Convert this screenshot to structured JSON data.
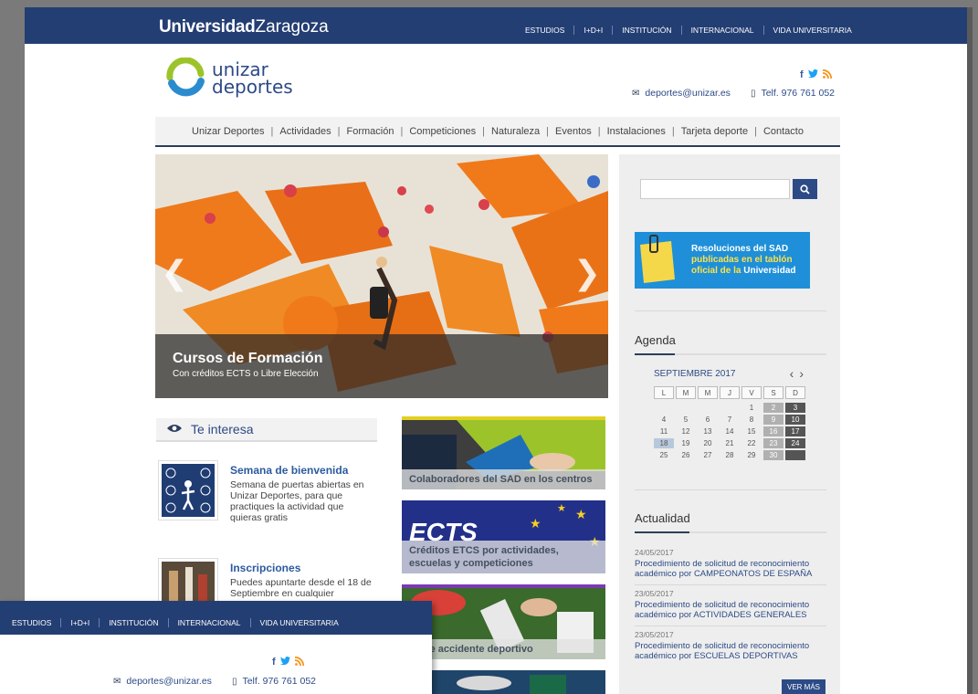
{
  "header": {
    "university_bold": "Universidad",
    "university_light": "Zaragoza",
    "topnav": [
      "ESTUDIOS",
      "I+D+I",
      "INSTITUCIÓN",
      "INTERNACIONAL",
      "VIDA UNIVERSITARIA"
    ]
  },
  "brand": {
    "line1": "unizar",
    "line2": "deportes"
  },
  "social": {
    "facebook": "f",
    "twitter": "🐦",
    "rss": "⟟"
  },
  "contact": {
    "email": "deportes@unizar.es",
    "phone": "Telf. 976 761 052"
  },
  "mainnav": [
    "Unizar Deportes",
    "Actividades",
    "Formación",
    "Competiciones",
    "Naturaleza",
    "Eventos",
    "Instalaciones",
    "Tarjeta deporte",
    "Contacto"
  ],
  "slider": {
    "title": "Cursos de Formación",
    "subtitle": "Con créditos ECTS o Libre Elección"
  },
  "te_interesa": {
    "title": "Te interesa",
    "items": [
      {
        "title": "Semana de bienvenida",
        "text": "Semana de puertas abiertas en Unizar Deportes, para que practiques la actividad que quieras gratis"
      },
      {
        "title": "Inscripciones",
        "text": "Puedes apuntarte desde el 18 de Septiembre en cualquier"
      }
    ]
  },
  "cards": [
    {
      "label": "Colaboradores del SAD en los centros"
    },
    {
      "label": "Créditos ETCS por actividades, escuelas y competiciones",
      "art_text": "ECTS"
    },
    {
      "label": "so de accidente deportivo"
    },
    {
      "label": ""
    }
  ],
  "sidebar": {
    "sad_banner": {
      "line1": "Resoluciones del SAD",
      "line2": "publicadas en el tablón",
      "line3a": "oficial de la ",
      "line3b": "Universidad"
    },
    "agenda_title": "Agenda",
    "calendar": {
      "month": "SEPTIEMBRE 2017",
      "days": [
        "L",
        "M",
        "M",
        "J",
        "V",
        "S",
        "D"
      ],
      "weeks": [
        [
          "",
          "",
          "",
          "",
          "1",
          "2",
          "3"
        ],
        [
          "4",
          "5",
          "6",
          "7",
          "8",
          "9",
          "10"
        ],
        [
          "11",
          "12",
          "13",
          "14",
          "15",
          "16",
          "17"
        ],
        [
          "18",
          "19",
          "20",
          "21",
          "22",
          "23",
          "24"
        ],
        [
          "25",
          "26",
          "27",
          "28",
          "29",
          "30",
          ""
        ]
      ],
      "today": "18"
    },
    "actualidad_title": "Actualidad",
    "news": [
      {
        "date": "24/05/2017",
        "title": "Procedimiento de solicitud de reconocimiento académico por CAMPEONATOS DE ESPAÑA"
      },
      {
        "date": "23/05/2017",
        "title": "Procedimiento de solicitud de reconocimiento académico por ACTIVIDADES GENERALES"
      },
      {
        "date": "23/05/2017",
        "title": "Procedimiento de solicitud de reconocimiento académico por ESCUELAS DEPORTIVAS"
      }
    ],
    "ver_mas": "VER MÁS"
  },
  "colors": {
    "brand_navy": "#233e73",
    "link_blue": "#2c4a86",
    "logo_green": "#9cc42a",
    "logo_blue": "#2a8ccf",
    "climbing_orange": "#f07a1a",
    "banner_blue": "#1e8fd8",
    "banner_yellow": "#ffe14a"
  }
}
